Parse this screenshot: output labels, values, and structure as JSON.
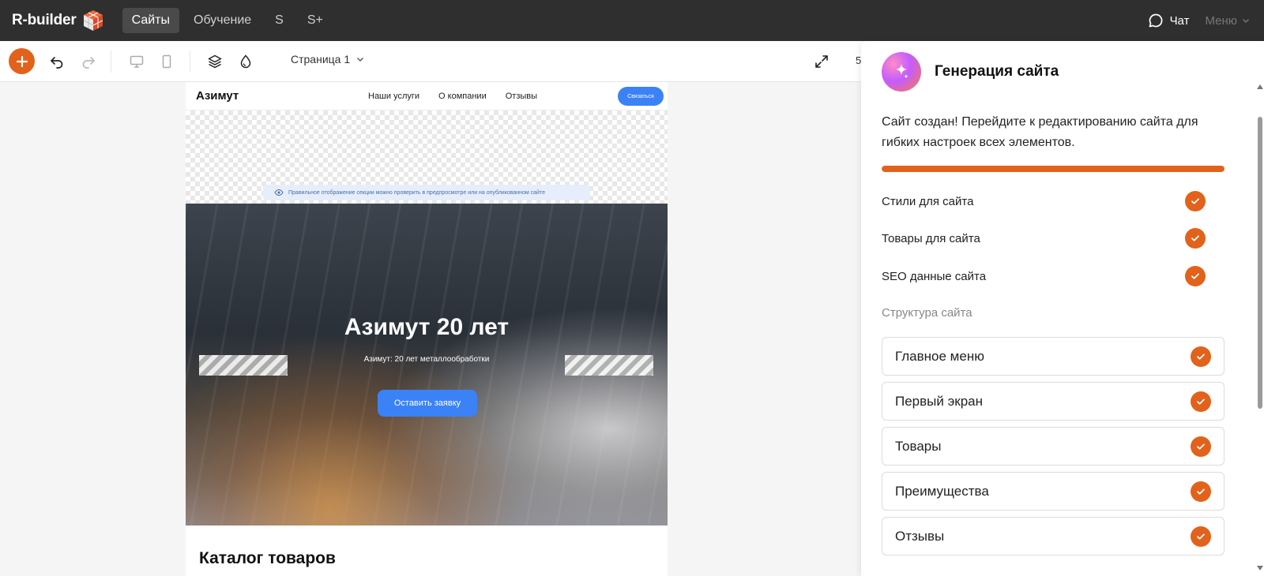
{
  "topbar": {
    "logo": "R-builder",
    "nav": [
      "Сайты",
      "Обучение",
      "S",
      "S+"
    ],
    "active_index": 0,
    "chat_label": "Чат",
    "menu_label": "Меню"
  },
  "toolbar": {
    "page_select": "Страница 1",
    "zoom_partial": "5"
  },
  "site": {
    "logo": "Азимут",
    "nav": [
      "Наши услуги",
      "О компании",
      "Отзывы"
    ],
    "cta": "Связаться",
    "preview_note": "Правильное отображение секции можно проверить в предпросмотре или на опубликованном сайте",
    "hero_title": "Азимут 20 лет",
    "hero_subtitle": "Азимут: 20 лет металлообработки",
    "hero_button": "Оставить заявку",
    "catalog_title": "Каталог товаров"
  },
  "panel": {
    "title": "Генерация сайта",
    "message": "Сайт создан! Перейдите к редактированию сайта для гибких настроек всех элементов.",
    "progress": 1.0,
    "status_items": [
      "Стили для сайта",
      "Товары для сайта",
      "SEO данные сайта"
    ],
    "structure_label": "Структура сайта",
    "structure_items": [
      "Главное меню",
      "Первый экран",
      "Товары",
      "Преимущества",
      "Отзывы"
    ]
  },
  "colors": {
    "accent": "#e2621b",
    "topbar": "#2f2f2f",
    "site_button": "#3b82f6"
  }
}
